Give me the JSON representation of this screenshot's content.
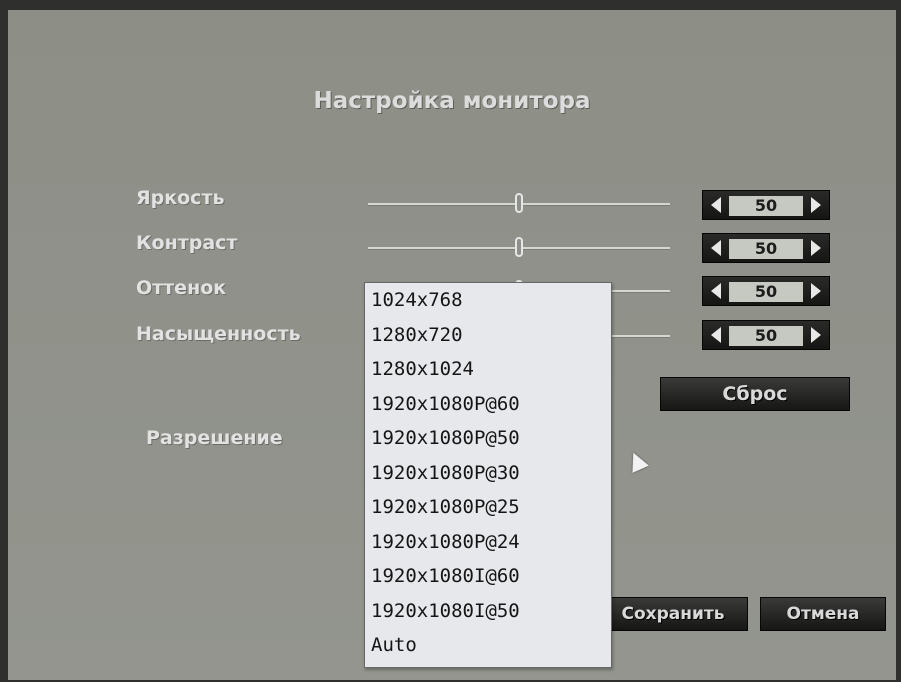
{
  "title": "Настройка монитора",
  "settings": [
    {
      "label": "Яркость",
      "value": "50",
      "level": 0.5
    },
    {
      "label": "Контраст",
      "value": "50",
      "level": 0.5
    },
    {
      "label": "Оттенок",
      "value": "50",
      "level": 0.5
    },
    {
      "label": "Насыщенность",
      "value": "50",
      "level": 0.5
    }
  ],
  "reset_label": "Сброс",
  "resolution_label": "Разрешение",
  "resolution_options": [
    "1024x768",
    "1280x720",
    "1280x1024",
    "1920x1080P@60",
    "1920x1080P@50",
    "1920x1080P@30",
    "1920x1080P@25",
    "1920x1080P@24",
    "1920x1080I@60",
    "1920x1080I@50",
    "Auto"
  ],
  "save_label": "Сохранить",
  "cancel_label": "Отмена",
  "colors": {
    "background": "#8f918a",
    "text": "#e2e2e2",
    "button": "#1a1a19",
    "dropdown": "#e7e8ec"
  }
}
